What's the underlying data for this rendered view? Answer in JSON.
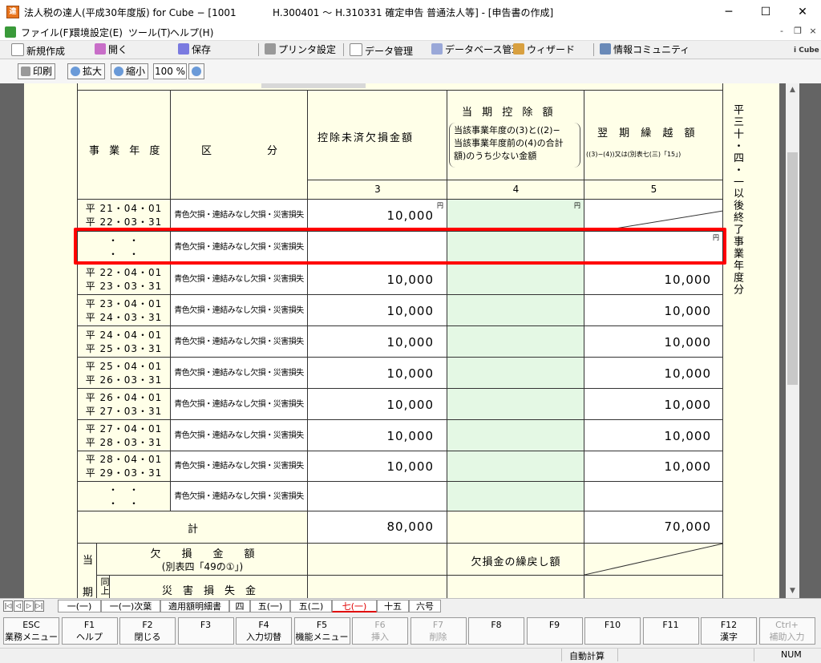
{
  "window": {
    "title_left": "法人税の達人(平成30年度版) for Cube − [1001",
    "title_right": "H.300401 〜 H.310331 確定申告 普通法人等] - [申告書の作成]",
    "minimize": "─",
    "maximize": "☐",
    "close": "✕"
  },
  "menu": {
    "items": [
      "ファイル(F)",
      "環境設定(E)",
      "ツール(T)",
      "ヘルプ(H)"
    ],
    "mdi_min": "-",
    "mdi_restore": "❐",
    "mdi_close": "×"
  },
  "toolbar": {
    "new": "新規作成",
    "open": "開く",
    "save": "保存",
    "printer": "プリンタ設定",
    "data": "データ管理",
    "db": "データベース管理",
    "wizard": "ウィザード",
    "community": "情報コミュニティ",
    "cube_logo": "i Cube"
  },
  "toolbar2": {
    "print": "印刷",
    "zoom_in": "拡大",
    "zoom_out": "縮小",
    "zoom_value": "100 %"
  },
  "form": {
    "col1_header": "事 業 年 度",
    "col2_header_a": "区",
    "col2_header_b": "分",
    "col3_header": "控除未済欠損金額",
    "col4_header_title": "当 期 控 除 額",
    "col4_header_sub1": "当該事業年度の(3)と((2)−",
    "col4_header_sub2": "当該事業年度前の(4)の合計",
    "col4_header_sub3": "額)のうち少ない金額",
    "col5_header_title": "翌 期 繰 越 額",
    "col5_header_sub": "((3)−(4))又は(別表七(三)「15」)",
    "col_nums": [
      "3",
      "4",
      "5"
    ],
    "yen": "円",
    "side_text_top": "平三十・四・一",
    "side_text_bottom": "以後終了事業年度分",
    "kubun_text": "青色欠損・連結みなし欠損・災害損失",
    "rows": [
      {
        "p1": "平 21・04・01",
        "p2": "平 22・03・31",
        "v3": "10,000",
        "v4": "",
        "v5": "",
        "diag5": true
      },
      {
        "p1": "・　・",
        "p2": "・　・",
        "v3": "",
        "v4": "",
        "v5": "",
        "diag5": false
      },
      {
        "p1": "平 22・04・01",
        "p2": "平 23・03・31",
        "v3": "10,000",
        "v4": "",
        "v5": "10,000",
        "diag5": false
      },
      {
        "p1": "平 23・04・01",
        "p2": "平 24・03・31",
        "v3": "10,000",
        "v4": "",
        "v5": "10,000",
        "diag5": false
      },
      {
        "p1": "平 24・04・01",
        "p2": "平 25・03・31",
        "v3": "10,000",
        "v4": "",
        "v5": "10,000",
        "diag5": false
      },
      {
        "p1": "平 25・04・01",
        "p2": "平 26・03・31",
        "v3": "10,000",
        "v4": "",
        "v5": "10,000",
        "diag5": false
      },
      {
        "p1": "平 26・04・01",
        "p2": "平 27・03・31",
        "v3": "10,000",
        "v4": "",
        "v5": "10,000",
        "diag5": false
      },
      {
        "p1": "平 27・04・01",
        "p2": "平 28・03・31",
        "v3": "10,000",
        "v4": "",
        "v5": "10,000",
        "diag5": false
      },
      {
        "p1": "平 28・04・01",
        "p2": "平 29・03・31",
        "v3": "10,000",
        "v4": "",
        "v5": "10,000",
        "diag5": false
      },
      {
        "p1": "・　・",
        "p2": "・　・",
        "v3": "",
        "v4": "",
        "v5": "",
        "diag5": false
      }
    ],
    "total_label": "計",
    "total_v3": "80,000",
    "total_v5": "70,000",
    "bottom_side_1": "当",
    "bottom_side_2": "期",
    "deficit_label": "欠　　損　　金　　額",
    "deficit_sub": "(別表四「49の①」)",
    "refund_label": "欠損金の繰戻し額",
    "same_label": "同上",
    "disaster_label": "災　害　損　失　金"
  },
  "sheet_tabs": {
    "nav": [
      "|◁",
      "◁",
      "▷",
      "▷|"
    ],
    "tabs": [
      "一(一)",
      "一(一)次葉",
      "適用額明細書",
      "四",
      "五(一)",
      "五(二)",
      "七(一)",
      "十五",
      "六号"
    ],
    "active_index": 6
  },
  "fkeys": [
    {
      "key": "ESC",
      "label": "業務メニュー",
      "enabled": true
    },
    {
      "key": "F1",
      "label": "ヘルプ",
      "enabled": true
    },
    {
      "key": "F2",
      "label": "閉じる",
      "enabled": true
    },
    {
      "key": "F3",
      "label": "",
      "enabled": true
    },
    {
      "key": "F4",
      "label": "入力切替",
      "enabled": true
    },
    {
      "key": "F5",
      "label": "機能メニュー",
      "enabled": true
    },
    {
      "key": "F6",
      "label": "挿入",
      "enabled": false
    },
    {
      "key": "F7",
      "label": "削除",
      "enabled": false
    },
    {
      "key": "F8",
      "label": "",
      "enabled": true
    },
    {
      "key": "F9",
      "label": "",
      "enabled": true
    },
    {
      "key": "F10",
      "label": "",
      "enabled": true
    },
    {
      "key": "F11",
      "label": "",
      "enabled": true
    },
    {
      "key": "F12",
      "label": "漢字",
      "enabled": true
    },
    {
      "key": "Ctrl+",
      "label": "補助入力",
      "enabled": false
    }
  ],
  "status": {
    "auto_calc": "自動計算",
    "num": "NUM"
  }
}
